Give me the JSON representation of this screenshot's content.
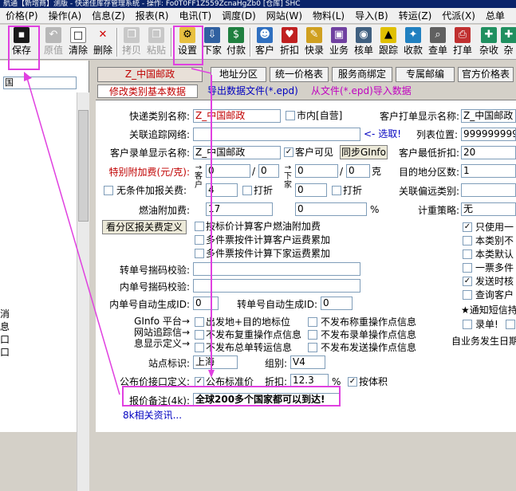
{
  "window": {
    "title": "航通【新增商】测版 - 快递佳库存管理系统 - 操作: Fo0T0FF1Z559ZcnaHgZb0 [仓库] SHC"
  },
  "menu": [
    "价格(P)",
    "操作(A)",
    "信息(Z)",
    "报表(R)",
    "电讯(T)",
    "调度(D)",
    "网站(W)",
    "物料(L)",
    "导入(B)",
    "转运(Z)",
    "代派(X)",
    "总单"
  ],
  "toolbar": [
    {
      "label": "保存",
      "icon": "save-icon",
      "enabled": true
    },
    {
      "label": "原值",
      "icon": "revert-icon",
      "enabled": false
    },
    {
      "label": "清除",
      "icon": "clear-icon",
      "enabled": true
    },
    {
      "label": "删除",
      "icon": "delete-icon",
      "enabled": true
    },
    {
      "label": "拷贝",
      "icon": "copy-icon",
      "enabled": false
    },
    {
      "label": "粘贴",
      "icon": "paste-icon",
      "enabled": false
    },
    {
      "label": "设置",
      "icon": "settings-icon",
      "enabled": true
    },
    {
      "label": "下家",
      "icon": "downstream-icon",
      "enabled": true
    },
    {
      "label": "付款",
      "icon": "payment-icon",
      "enabled": true
    },
    {
      "label": "客户",
      "icon": "customer-icon",
      "enabled": true
    },
    {
      "label": "折扣",
      "icon": "discount-icon",
      "enabled": true
    },
    {
      "label": "快录",
      "icon": "quick-entry-icon",
      "enabled": true
    },
    {
      "label": "业务",
      "icon": "business-icon",
      "enabled": true
    },
    {
      "label": "核单",
      "icon": "verify-icon",
      "enabled": true
    },
    {
      "label": "跟踪",
      "icon": "track-icon",
      "enabled": true
    },
    {
      "label": "收款",
      "icon": "receive-icon",
      "enabled": true
    },
    {
      "label": "查单",
      "icon": "search-order-icon",
      "enabled": true
    },
    {
      "label": "打单",
      "icon": "print-icon",
      "enabled": true
    },
    {
      "label": "杂收",
      "icon": "misc-income-icon",
      "enabled": true
    },
    {
      "label": "杂",
      "icon": "misc-icon",
      "enabled": true
    }
  ],
  "left_panel": {
    "items": [
      "国",
      "消",
      "息",
      "口",
      "口"
    ]
  },
  "tabs": {
    "current": "Z_中国邮政",
    "buttons": [
      "地址分区",
      "统一价格表",
      "服务商绑定",
      "专属邮编",
      "官方价格表"
    ],
    "sub_modify": "修改类别基本数据",
    "sub_export": "导出数据文件(*.epd)",
    "sub_import": "从文件(*.epd)导入数据"
  },
  "form": {
    "quick_name_label": "快递类别名称:",
    "quick_name_value": "Z_中国邮政",
    "city_label": "市内[自营]",
    "print_name_label": "客户打单显示名称:",
    "print_name_value": "Z_中国邮政",
    "tracking_label": "关联追踪网络:",
    "select_label": "<- 选取!",
    "list_pos_label": "列表位置:",
    "list_pos_value": "999999999",
    "entry_name_label": "客户录单显示名称:",
    "entry_name_value": "Z_中国邮政",
    "customer_visible_label": "客户可见",
    "sync_gifo_label": "同步GInfo",
    "min_discount_label": "客户最低折扣:",
    "min_discount_value": "20",
    "surcharge_label": "特别附加费(元/克):",
    "surcharge_cust_1": "0",
    "surcharge_cust_2": "0",
    "surcharge_down_1": "0",
    "surcharge_down_2": "0",
    "gram_label": "克",
    "arrow_cust": "→客户",
    "arrow_down": "→下家",
    "dest_zone_label": "目的地分区数:",
    "dest_zone_value": "1",
    "unconditional_label": "无条件加报关费:",
    "customs_cust": "4",
    "discount_label_1": "打折",
    "customs_down": "0",
    "discount_label_2": "打折",
    "remote_label": "关联偏远类别:",
    "fuel_label": "燃油附加费:",
    "fuel_cust": "17",
    "fuel_down": "0",
    "percent": "%",
    "plan_label": "计重策略:",
    "plan_value": "无",
    "view_customs_btn": "看分区报关费定义",
    "fuel_opt_1": "按标价计算客户燃油附加费",
    "fuel_opt_2": "多件票按件计算客户运费累加",
    "fuel_opt_3": "多件票按件计算下家运费累加",
    "right_opts": [
      "只使用一",
      "本类别不",
      "本类默认",
      "一票多件",
      "发送时核",
      "查询客户"
    ],
    "right_checked": [
      true,
      false,
      false,
      false,
      true,
      false
    ],
    "sms_label": "★通知短信持",
    "record_label": "录单!",
    "transfer_check_label": "转单号揣码校验:",
    "inner_check_label": "内单号揣码校验:",
    "inner_auto_label": "内单号自动生成ID:",
    "inner_auto_value": "0",
    "transfer_auto_label": "转单号自动生成ID:",
    "transfer_auto_value": "0",
    "gifo_platform": "GInfo 平台→",
    "website_track": "网站追踪信→",
    "display_def": "息显示定义→",
    "opt_a1": "出发地+目的地标位",
    "opt_a2": "不发布复重操作点信息",
    "opt_a3": "不发布总单转运信息",
    "opt_b1": "不发布称重操作点信息",
    "opt_b2": "不发布录单操作点信息",
    "opt_b3": "不发布发送操作点信息",
    "business_date_label": "自业务发生日期",
    "station_label": "站点标识:",
    "station_value": "上海",
    "group_label": "组别:",
    "group_value": "V4",
    "public_price_label": "公布价接口定义:",
    "public_price_check": "公布标准价",
    "discount_label": "折扣:",
    "discount_value": "12.3",
    "by_volume_label": "按体积",
    "remark_label": "报价备注(4k):",
    "remark_value": "全球200多个国家都可以到达!",
    "related_info": "8k相关资讯...",
    "fixed_label": "0.0"
  },
  "colors": {
    "highlight": "#e040e0",
    "red_text": "#c00000",
    "blue_text": "#0000c0",
    "magenta_text": "#c000c0"
  }
}
